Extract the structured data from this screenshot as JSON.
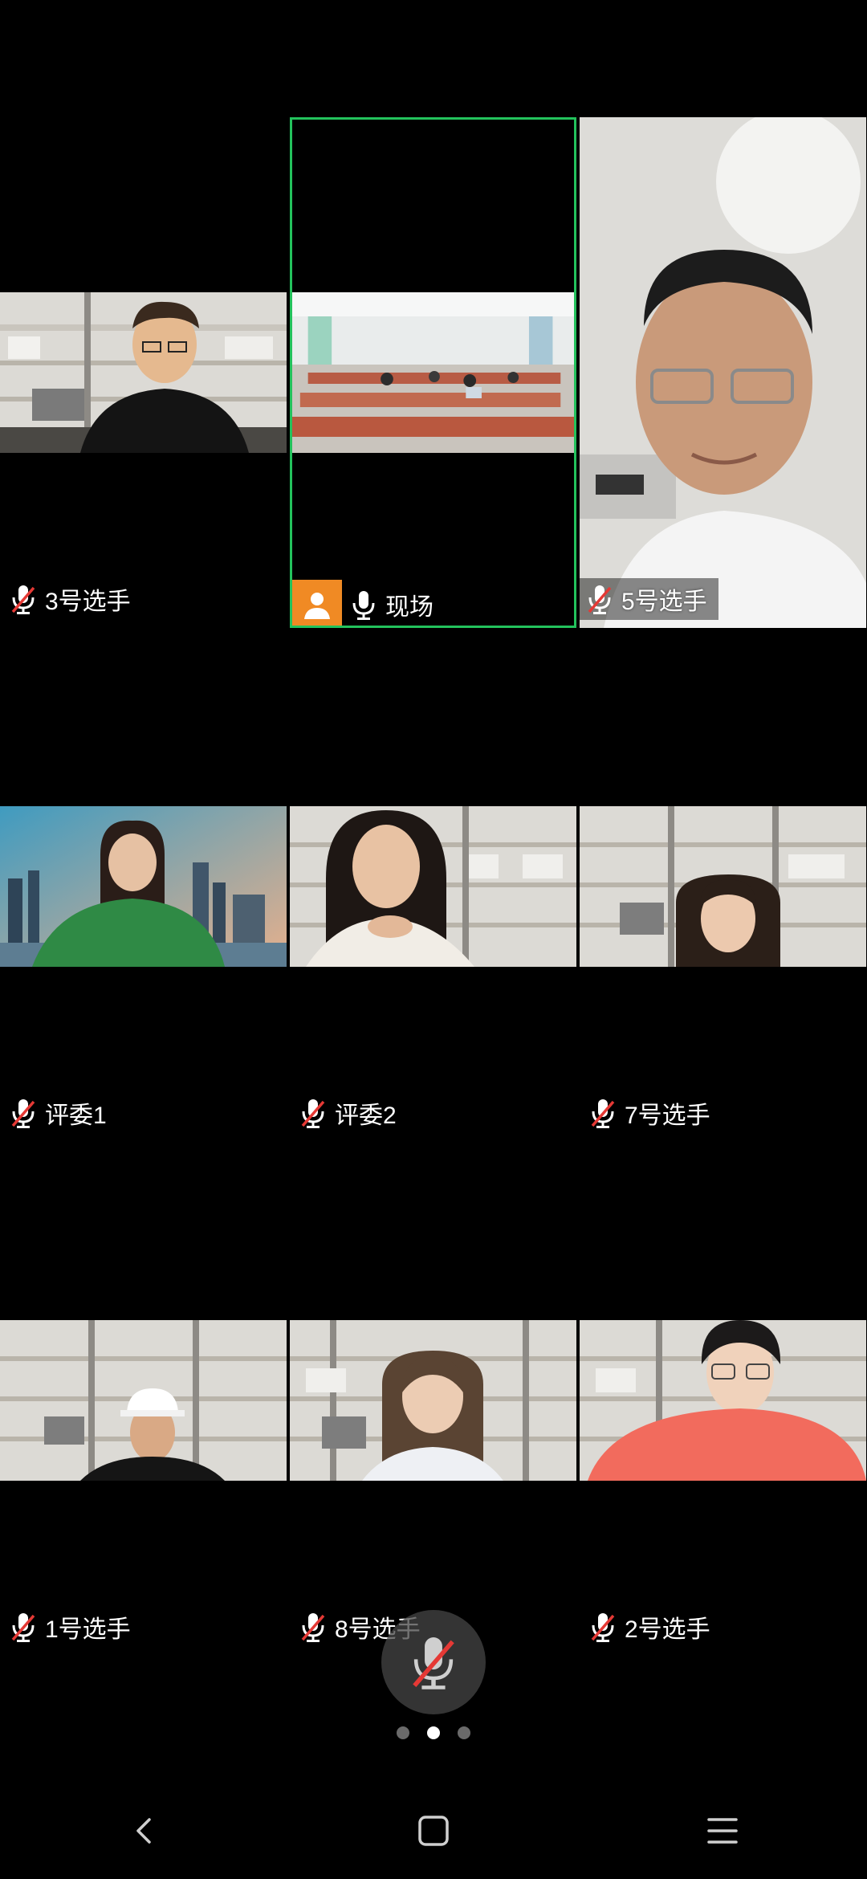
{
  "tiles": [
    {
      "name": "3号选手",
      "mic": "muted"
    },
    {
      "name": "现场",
      "mic": "on",
      "active": true
    },
    {
      "name": "5号选手",
      "mic": "muted"
    },
    {
      "name": "评委1",
      "mic": "muted"
    },
    {
      "name": "评委2",
      "mic": "muted"
    },
    {
      "name": "7号选手",
      "mic": "muted"
    },
    {
      "name": "1号选手",
      "mic": "muted"
    },
    {
      "name": "8号选手",
      "mic": "muted"
    },
    {
      "name": "2号选手",
      "mic": "muted"
    }
  ],
  "icons": {
    "mic_muted": "mic-muted-icon",
    "mic_on": "mic-icon",
    "avatar": "person-icon",
    "floating": "mic-muted-icon",
    "nav": [
      "back-icon",
      "home-icon",
      "menu-icon"
    ]
  },
  "pager": {
    "count": 3,
    "current": 2
  },
  "colors": {
    "active_border": "#23c25c",
    "avatar_badge": "#f08a24",
    "mute_slash": "#e53935",
    "background": "#000000"
  }
}
